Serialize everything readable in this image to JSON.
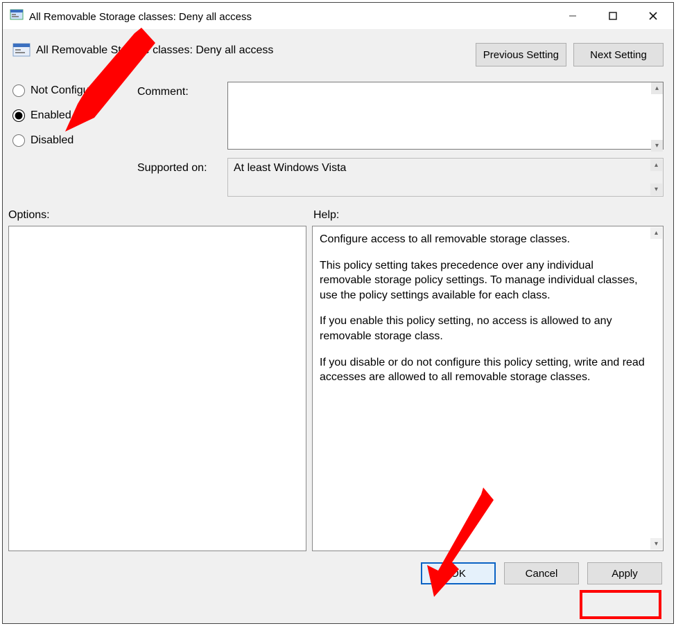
{
  "window": {
    "title": "All Removable Storage classes: Deny all access"
  },
  "header": {
    "title": "All Removable Storage classes: Deny all access",
    "prev_label": "Previous Setting",
    "next_label": "Next Setting"
  },
  "radios": {
    "not_configured": "Not Configured",
    "enabled": "Enabled",
    "disabled": "Disabled",
    "selected": "enabled"
  },
  "fields": {
    "comment_label": "Comment:",
    "comment_value": "",
    "supported_label": "Supported on:",
    "supported_value": "At least Windows Vista"
  },
  "panes": {
    "options_label": "Options:",
    "help_label": "Help:",
    "help_paragraphs": [
      "Configure access to all removable storage classes.",
      "This policy setting takes precedence over any individual removable storage policy settings. To manage individual classes, use the policy settings available for each class.",
      "If you enable this policy setting, no access is allowed to any removable storage class.",
      "If you disable or do not configure this policy setting, write and read accesses are allowed to all removable storage classes."
    ]
  },
  "buttons": {
    "ok": "OK",
    "cancel": "Cancel",
    "apply": "Apply"
  }
}
